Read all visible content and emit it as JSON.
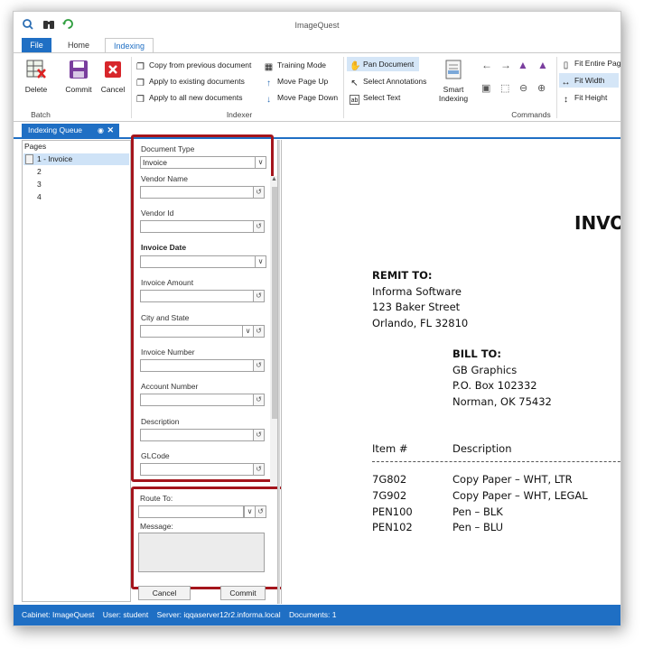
{
  "app": {
    "title": "ImageQuest"
  },
  "ribbon": {
    "tabs": [
      {
        "label": "File"
      },
      {
        "label": "Home"
      },
      {
        "label": "Indexing"
      }
    ],
    "batch": {
      "group_label": "Batch",
      "delete_label": "Delete",
      "commit_label": "Commit",
      "cancel_label": "Cancel"
    },
    "indexer": {
      "group_label": "Indexer",
      "copy_prev": "Copy from previous document",
      "apply_existing": "Apply to existing documents",
      "apply_new": "Apply to all new documents",
      "training_mode": "Training Mode",
      "move_up": "Move Page Up",
      "move_down": "Move Page Down"
    },
    "commands": {
      "group_label": "Commands",
      "pan_document": "Pan Document",
      "select_annotations": "Select Annotations",
      "select_text": "Select Text",
      "smart_indexing_line1": "Smart",
      "smart_indexing_line2": "Indexing",
      "fit_entire_page": "Fit Entire Pag",
      "fit_width": "Fit Width",
      "fit_height": "Fit Height"
    }
  },
  "pane": {
    "tab_label": "Indexing Queue"
  },
  "pages": {
    "title": "Pages",
    "items": [
      {
        "label": "1 - Invoice"
      },
      {
        "label": "2"
      },
      {
        "label": "3"
      },
      {
        "label": "4"
      }
    ]
  },
  "indexing_form": {
    "document_type": {
      "label": "Document Type",
      "value": "Invoice"
    },
    "vendor_name": {
      "label": "Vendor Name",
      "value": ""
    },
    "vendor_id": {
      "label": "Vendor Id",
      "value": ""
    },
    "invoice_date": {
      "label": "Invoice Date",
      "value": ""
    },
    "invoice_amount": {
      "label": "Invoice Amount",
      "value": ""
    },
    "city_state": {
      "label": "City and State",
      "value": ""
    },
    "invoice_number": {
      "label": "Invoice Number",
      "value": ""
    },
    "account_number": {
      "label": "Account Number",
      "value": ""
    },
    "description": {
      "label": "Description",
      "value": ""
    },
    "glcode": {
      "label": "GLCode",
      "value": ""
    }
  },
  "routing": {
    "route_to_label": "Route To:",
    "route_to_value": "",
    "message_label": "Message:",
    "message_value": ""
  },
  "actions": {
    "cancel_label": "Cancel",
    "commit_label": "Commit"
  },
  "document": {
    "title": "INVOI",
    "remit_to_heading": "REMIT TO:",
    "remit_lines": [
      "Informa Software",
      "123 Baker Street",
      "Orlando, FL  32810"
    ],
    "bill_to_heading": "BILL TO:",
    "bill_lines": [
      "GB Graphics",
      "P.O. Box 102332",
      "Norman, OK  75432"
    ],
    "col_item": "Item #",
    "col_description": "Description",
    "rows": [
      {
        "item": "7G802",
        "description": "Copy Paper – WHT, LTR"
      },
      {
        "item": "7G902",
        "description": "Copy Paper – WHT, LEGAL"
      },
      {
        "item": "PEN100",
        "description": "Pen – BLK"
      },
      {
        "item": "PEN102",
        "description": "Pen – BLU"
      }
    ]
  },
  "status": {
    "cabinet": "Cabinet: ImageQuest",
    "user": "User: student",
    "server": "Server: iqqaserver12r2.informa.local",
    "documents": "Documents: 1"
  },
  "colors": {
    "accent": "#1f6fc4",
    "highlight_box": "#a4151c",
    "selected_row": "#cfe3f7"
  }
}
